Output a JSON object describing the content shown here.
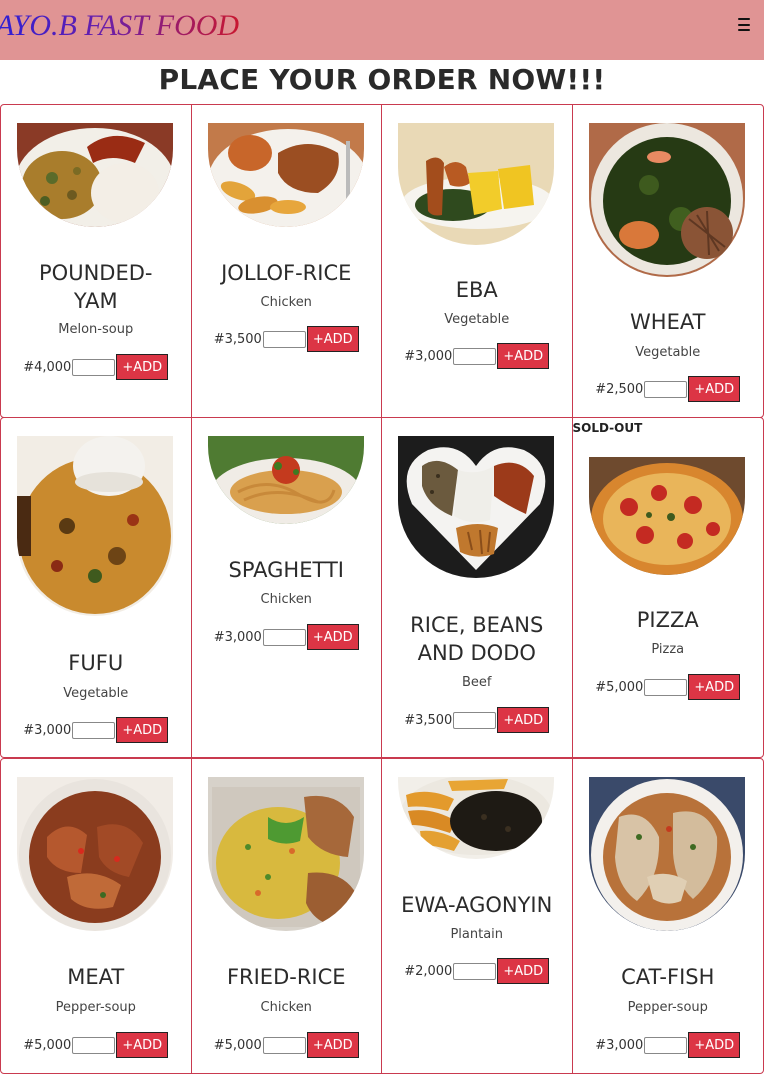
{
  "brand": "AYO.B FAST FOOD",
  "heading": "PLACE YOUR ORDER NOW!!!",
  "add_label": "+ADD",
  "items": [
    {
      "name": "POUNDED-YAM",
      "sub": "Melon-soup",
      "price": "#4,000"
    },
    {
      "name": "JOLLOF-RICE",
      "sub": "Chicken",
      "price": "#3,500"
    },
    {
      "name": "EBA",
      "sub": "Vegetable",
      "price": "#3,000"
    },
    {
      "name": "WHEAT",
      "sub": "Vegetable",
      "price": "#2,500"
    },
    {
      "name": "FUFU",
      "sub": "Vegetable",
      "price": "#3,000"
    },
    {
      "name": "SPAGHETTI",
      "sub": "Chicken",
      "price": "#3,000"
    },
    {
      "name": "RICE, BEANS AND DODO",
      "sub": "Beef",
      "price": "#3,500"
    },
    {
      "name": "PIZZA",
      "sub": "Pizza",
      "price": "#5,000",
      "badge": "SOLD-OUT"
    },
    {
      "name": "MEAT",
      "sub": "Pepper-soup",
      "price": "#5,000"
    },
    {
      "name": "FRIED-RICE",
      "sub": "Chicken",
      "price": "#5,000"
    },
    {
      "name": "EWA-AGONYIN",
      "sub": "Plantain",
      "price": "#2,000"
    },
    {
      "name": "CAT-FISH",
      "sub": "Pepper-soup",
      "price": "#3,000"
    }
  ]
}
